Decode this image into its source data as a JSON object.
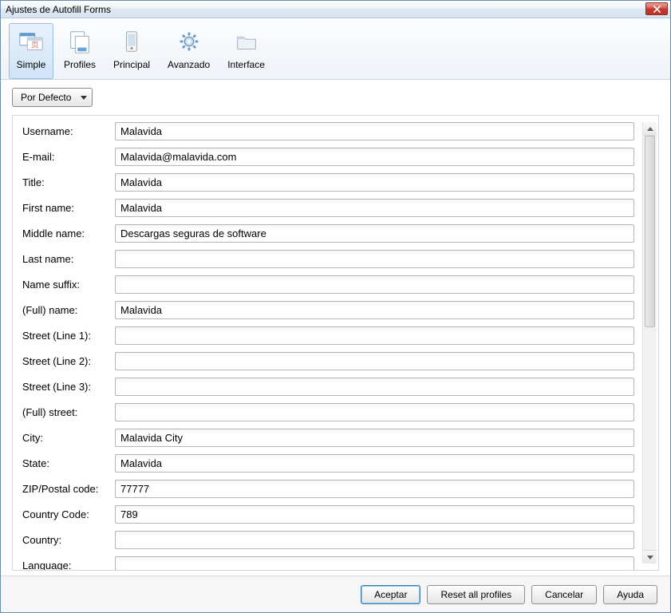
{
  "window": {
    "title": "Ajustes de Autofill Forms"
  },
  "toolbar": {
    "items": [
      {
        "label": "Simple",
        "icon": "simple-icon",
        "selected": true
      },
      {
        "label": "Profiles",
        "icon": "profiles-icon",
        "selected": false
      },
      {
        "label": "Principal",
        "icon": "principal-icon",
        "selected": false
      },
      {
        "label": "Avanzado",
        "icon": "advanced-icon",
        "selected": false
      },
      {
        "label": "Interface",
        "icon": "interface-icon",
        "selected": false
      }
    ]
  },
  "dropdown": {
    "selected": "Por Defecto"
  },
  "fields": [
    {
      "label": "Username:",
      "value": "Malavida"
    },
    {
      "label": "E-mail:",
      "value": "Malavida@malavida.com"
    },
    {
      "label": "Title:",
      "value": "Malavida"
    },
    {
      "label": "First name:",
      "value": "Malavida"
    },
    {
      "label": "Middle name:",
      "value": "Descargas seguras de software"
    },
    {
      "label": "Last name:",
      "value": ""
    },
    {
      "label": "Name suffix:",
      "value": ""
    },
    {
      "label": "(Full) name:",
      "value": "Malavida"
    },
    {
      "label": "Street (Line 1):",
      "value": ""
    },
    {
      "label": "Street (Line 2):",
      "value": ""
    },
    {
      "label": "Street (Line 3):",
      "value": ""
    },
    {
      "label": "(Full) street:",
      "value": ""
    },
    {
      "label": "City:",
      "value": "Malavida City"
    },
    {
      "label": "State:",
      "value": "Malavida"
    },
    {
      "label": "ZIP/Postal code:",
      "value": "77777"
    },
    {
      "label": "Country Code:",
      "value": "789"
    },
    {
      "label": "Country:",
      "value": ""
    },
    {
      "label": "Language:",
      "value": ""
    }
  ],
  "footer": {
    "accept": "Aceptar",
    "reset": "Reset all profiles",
    "cancel": "Cancelar",
    "help": "Ayuda"
  }
}
